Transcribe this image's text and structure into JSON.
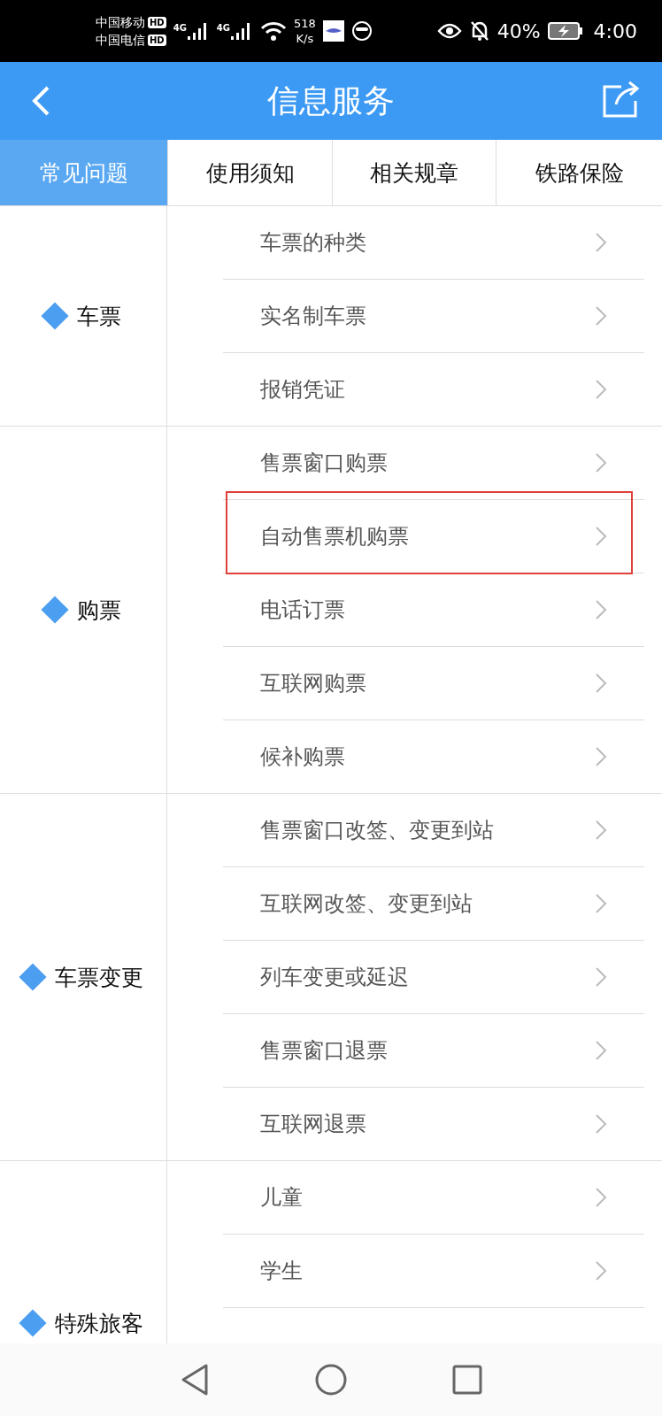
{
  "status_bar": {
    "carriers": [
      {
        "name": "中国移动",
        "badge": "HD"
      },
      {
        "name": "中国电信",
        "badge": "HD"
      }
    ],
    "networks": [
      "4G",
      "4G"
    ],
    "speed": {
      "value": "518",
      "unit": "K/s"
    },
    "battery": "40%",
    "time": "4:00"
  },
  "header": {
    "title": "信息服务"
  },
  "tabs": [
    {
      "label": "常见问题",
      "selected": true
    },
    {
      "label": "使用须知",
      "selected": false
    },
    {
      "label": "相关规章",
      "selected": false
    },
    {
      "label": "铁路保险",
      "selected": false
    }
  ],
  "groups": [
    {
      "label": "车票",
      "items": [
        {
          "label": "车票的种类",
          "highlighted": false
        },
        {
          "label": "实名制车票",
          "highlighted": false
        },
        {
          "label": "报销凭证",
          "highlighted": false
        }
      ]
    },
    {
      "label": "购票",
      "items": [
        {
          "label": "售票窗口购票",
          "highlighted": false
        },
        {
          "label": "自动售票机购票",
          "highlighted": true
        },
        {
          "label": "电话订票",
          "highlighted": false
        },
        {
          "label": "互联网购票",
          "highlighted": false
        },
        {
          "label": "候补购票",
          "highlighted": false
        }
      ]
    },
    {
      "label": "车票变更",
      "items": [
        {
          "label": "售票窗口改签、变更到站",
          "highlighted": false
        },
        {
          "label": "互联网改签、变更到站",
          "highlighted": false
        },
        {
          "label": "列车变更或延迟",
          "highlighted": false
        },
        {
          "label": "售票窗口退票",
          "highlighted": false
        },
        {
          "label": "互联网退票",
          "highlighted": false
        }
      ]
    },
    {
      "label": "特殊旅客",
      "items": [
        {
          "label": "儿童",
          "highlighted": false
        },
        {
          "label": "学生",
          "highlighted": false
        }
      ]
    }
  ]
}
